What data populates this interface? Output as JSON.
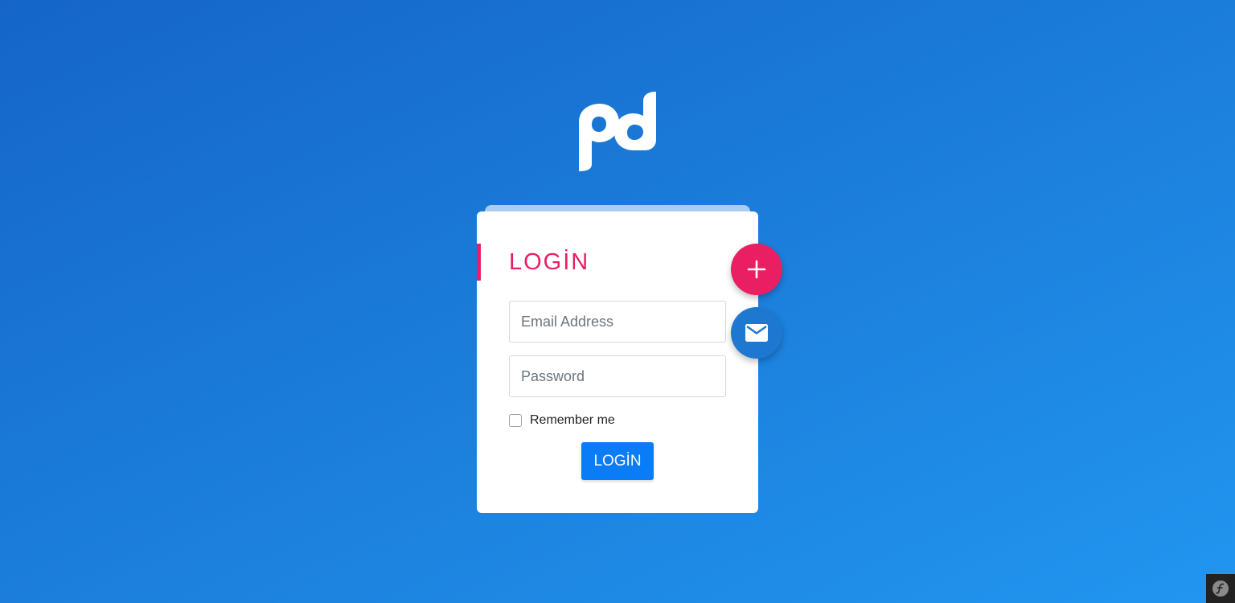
{
  "logo": {
    "icon": "pd-logo-icon",
    "color": "#ffffff"
  },
  "login_card": {
    "title": "LOGİN",
    "accent_color": "#e91e63",
    "email_placeholder": "Email Address",
    "email_value": "",
    "password_placeholder": "Password",
    "password_value": "",
    "remember_label": "Remember me",
    "remember_checked": false,
    "submit_label": "LOGİN",
    "submit_color": "#0a7cf5"
  },
  "fabs": {
    "add_icon": "plus-icon",
    "add_color": "#e91e63",
    "mail_icon": "mail-icon",
    "mail_color": "#1e77d0"
  },
  "corner_badge": {
    "icon": "symfony-toolbar-icon"
  }
}
